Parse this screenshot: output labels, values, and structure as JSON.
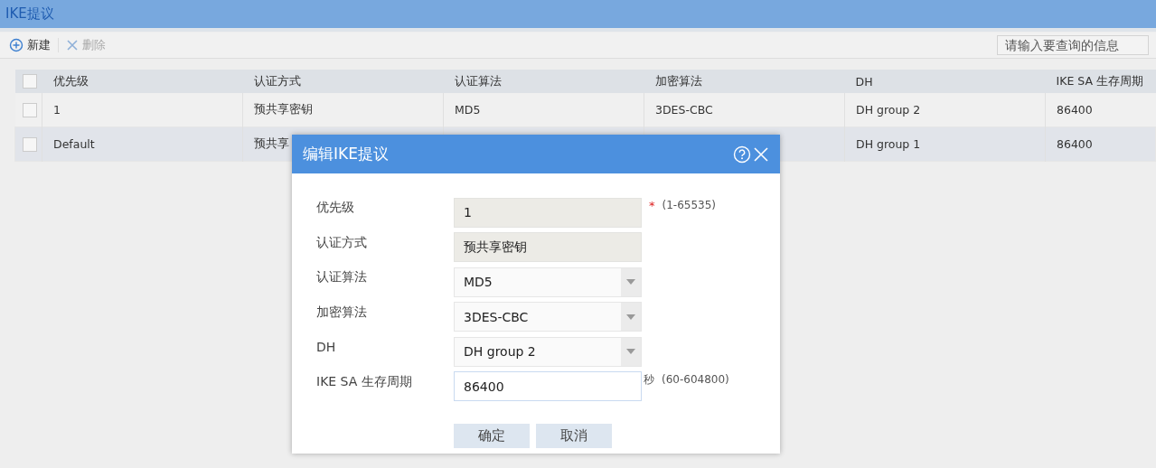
{
  "window": {
    "title": "IKE提议"
  },
  "toolbar": {
    "buttons": [
      {
        "label": "新建",
        "kind": "add",
        "disabled": false
      },
      {
        "label": "删除",
        "kind": "delete",
        "disabled": true
      }
    ],
    "search": {
      "placeholder": "请输入要查询的信息"
    }
  },
  "table": {
    "all_checked": false,
    "columns": [
      "优先级",
      "认证方式",
      "认证算法",
      "加密算法",
      "DH",
      "IKE SA 生存周期"
    ],
    "rows": [
      {
        "selected": false,
        "checked": false,
        "cells": [
          "1",
          "预共享密钥",
          "MD5",
          "3DES-CBC",
          "DH group 2",
          "86400"
        ]
      },
      {
        "selected": true,
        "checked": false,
        "cells": [
          "Default",
          "预共享",
          null,
          null,
          "DH group 1",
          "86400"
        ]
      }
    ]
  },
  "dialog": {
    "title": "编辑IKE提议",
    "fields": [
      {
        "label": "优先级",
        "kind": "readonly",
        "value": "1",
        "marker": "*",
        "hint": "(1-65535)"
      },
      {
        "label": "认证方式",
        "kind": "readonly",
        "value": "预共享密钥"
      },
      {
        "label": "认证算法",
        "kind": "select",
        "value": "MD5"
      },
      {
        "label": "加密算法",
        "kind": "select",
        "value": "3DES-CBC"
      },
      {
        "label": "DH",
        "kind": "select",
        "value": "DH group 2"
      },
      {
        "label": "IKE SA 生存周期",
        "kind": "input",
        "value": "86400",
        "unit": "秒",
        "hint": "(60-604800)"
      }
    ],
    "buttons": [
      "确定",
      "取消"
    ]
  }
}
